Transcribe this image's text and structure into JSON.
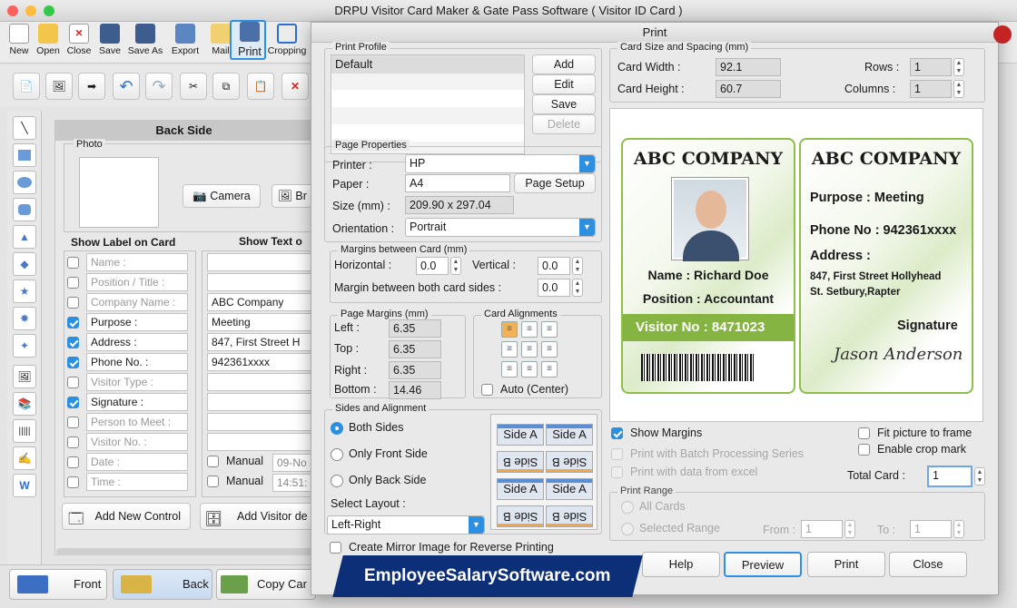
{
  "window": {
    "title": "DRPU Visitor Card Maker & Gate Pass Software ( Visitor ID Card )"
  },
  "toolbar": {
    "items": [
      "New",
      "Open",
      "Close",
      "Save",
      "Save As",
      "Export",
      "Mail",
      "Print",
      "Cropping"
    ]
  },
  "design": {
    "header": "Back Side",
    "photo_label": "Photo",
    "camera_label": "Camera",
    "browse_label": "Br",
    "show_label_header": "Show Label on Card",
    "show_text_header": "Show Text o",
    "labels": [
      {
        "text": "Name :",
        "checked": false,
        "value": ""
      },
      {
        "text": "Position / Title :",
        "checked": false,
        "value": ""
      },
      {
        "text": "Company Name :",
        "checked": false,
        "value": "ABC Company"
      },
      {
        "text": "Purpose :",
        "checked": true,
        "value": "Meeting"
      },
      {
        "text": "Address :",
        "checked": true,
        "value": "847, First Street H"
      },
      {
        "text": "Phone No. :",
        "checked": true,
        "value": "942361xxxx"
      },
      {
        "text": "Visitor Type :",
        "checked": false,
        "value": ""
      },
      {
        "text": "Signature :",
        "checked": true,
        "value": ""
      },
      {
        "text": "Person to Meet :",
        "checked": false,
        "value": ""
      },
      {
        "text": "Visitor No. :",
        "checked": false,
        "value": ""
      },
      {
        "text": "Date :",
        "checked": false,
        "value": ""
      },
      {
        "text": "Time :",
        "checked": false,
        "value": ""
      }
    ],
    "manual_label": "Manual",
    "date_value": "09-No",
    "time_value": "14:51:",
    "add_control": "Add New Control",
    "add_visitor": "Add Visitor de"
  },
  "bottom_tabs": {
    "front": "Front",
    "back": "Back",
    "copy": "Copy Car"
  },
  "banner": "EmployeeSalarySoftware.com",
  "dialog": {
    "title": "Print",
    "print_profile": {
      "label": "Print Profile",
      "items": [
        "Default"
      ],
      "add": "Add",
      "edit": "Edit",
      "save": "Save",
      "delete": "Delete"
    },
    "page_properties": {
      "label": "Page Properties",
      "printer_label": "Printer :",
      "printer": "HP",
      "paper_label": "Paper :",
      "paper": "A4",
      "page_setup": "Page Setup",
      "size_label": "Size (mm) :",
      "size": "209.90 x 297.04",
      "orientation_label": "Orientation :",
      "orientation": "Portrait"
    },
    "margins_between": {
      "label": "Margins between Card (mm)",
      "horizontal_label": "Horizontal :",
      "horizontal": "0.0",
      "vertical_label": "Vertical :",
      "vertical": "0.0",
      "both_label": "Margin between both card sides :",
      "both": "0.0"
    },
    "page_margins": {
      "label": "Page Margins (mm)",
      "left_label": "Left :",
      "left": "6.35",
      "top_label": "Top :",
      "top": "6.35",
      "right_label": "Right :",
      "right": "6.35",
      "bottom_label": "Bottom :",
      "bottom": "14.46"
    },
    "card_alignments": {
      "label": "Card Alignments",
      "auto_center": "Auto (Center)"
    },
    "sides": {
      "label": "Sides and Alignment",
      "both": "Both Sides",
      "front": "Only Front Side",
      "back": "Only Back Side",
      "select_layout": "Select Layout :",
      "layout": "Left-Right",
      "side_a": "Side A",
      "side_b": "Side B"
    },
    "mirror": "Create Mirror Image for Reverse Printing",
    "card_size": {
      "label": "Card Size and Spacing (mm)",
      "width_label": "Card Width :",
      "width": "92.1",
      "height_label": "Card Height :",
      "height": "60.7",
      "rows_label": "Rows :",
      "rows": "1",
      "columns_label": "Columns :",
      "columns": "1"
    },
    "preview_card_front": {
      "company": "ABC COMPANY",
      "name": "Name : Richard Doe",
      "position": "Position :  Accountant",
      "visitor_no": "Visitor No :  8471023"
    },
    "preview_card_back": {
      "company": "ABC COMPANY",
      "purpose": "Purpose : Meeting",
      "phone": "Phone No : 942361xxxx",
      "address_label": "Address :",
      "address1": "847, First Street Hollyhead",
      "address2": "St. Setbury,Rapter",
      "signature_label": "Signature",
      "signature": "Jason Anderson"
    },
    "options": {
      "show_margins": "Show Margins",
      "batch": "Print with Batch Processing Series",
      "excel": "Print with data from excel",
      "fit": "Fit picture to frame",
      "crop": "Enable crop mark",
      "total_label": "Total Card :",
      "total": "1"
    },
    "print_range": {
      "label": "Print Range",
      "all": "All Cards",
      "selected": "Selected Range",
      "from_label": "From :",
      "from": "1",
      "to_label": "To :",
      "to": "1"
    },
    "buttons": {
      "help": "Help",
      "preview": "Preview",
      "print": "Print",
      "close": "Close"
    }
  },
  "colors": {
    "accent": "#2d8fe0",
    "card_green": "#8dbf4a",
    "banner": "#0c2f78"
  }
}
